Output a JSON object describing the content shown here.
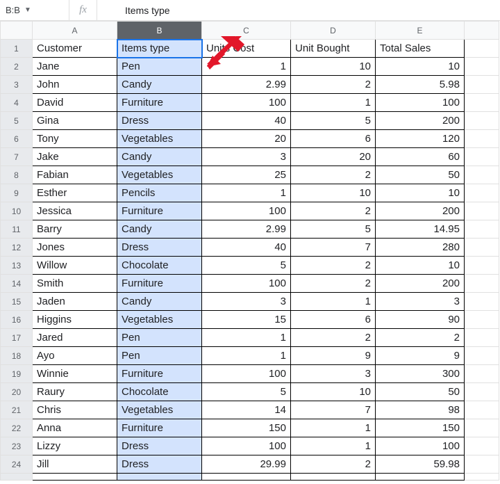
{
  "namebox": "B:B",
  "fx_label": "fx",
  "formula_value": "Items type",
  "columns": [
    "A",
    "B",
    "C",
    "D",
    "E"
  ],
  "selected_column": "B",
  "headers": [
    "Customer",
    "Items type",
    "Units Cost",
    "Unit Bought",
    "Total Sales"
  ],
  "rows": [
    {
      "n": 1,
      "a": "Customer",
      "b": "Items type",
      "c": "Units Cost",
      "d": "Unit Bought",
      "e": "Total Sales",
      "hdr": true
    },
    {
      "n": 2,
      "a": "Jane",
      "b": "Pen",
      "c": "1",
      "d": "10",
      "e": "10"
    },
    {
      "n": 3,
      "a": "John",
      "b": "Candy",
      "c": "2.99",
      "d": "2",
      "e": "5.98"
    },
    {
      "n": 4,
      "a": "David",
      "b": "Furniture",
      "c": "100",
      "d": "1",
      "e": "100"
    },
    {
      "n": 5,
      "a": "Gina",
      "b": "Dress",
      "c": "40",
      "d": "5",
      "e": "200"
    },
    {
      "n": 6,
      "a": "Tony",
      "b": "Vegetables",
      "c": "20",
      "d": "6",
      "e": "120"
    },
    {
      "n": 7,
      "a": "Jake",
      "b": "Candy",
      "c": "3",
      "d": "20",
      "e": "60"
    },
    {
      "n": 8,
      "a": "Fabian",
      "b": "Vegetables",
      "c": "25",
      "d": "2",
      "e": "50"
    },
    {
      "n": 9,
      "a": "Esther",
      "b": "Pencils",
      "c": "1",
      "d": "10",
      "e": "10"
    },
    {
      "n": 10,
      "a": "Jessica",
      "b": "Furniture",
      "c": "100",
      "d": "2",
      "e": "200"
    },
    {
      "n": 11,
      "a": "Barry",
      "b": "Candy",
      "c": "2.99",
      "d": "5",
      "e": "14.95"
    },
    {
      "n": 12,
      "a": "Jones",
      "b": "Dress",
      "c": "40",
      "d": "7",
      "e": "280"
    },
    {
      "n": 13,
      "a": "Willow",
      "b": "Chocolate",
      "c": "5",
      "d": "2",
      "e": "10"
    },
    {
      "n": 14,
      "a": "Smith",
      "b": "Furniture",
      "c": "100",
      "d": "2",
      "e": "200"
    },
    {
      "n": 15,
      "a": "Jaden",
      "b": "Candy",
      "c": "3",
      "d": "1",
      "e": "3"
    },
    {
      "n": 16,
      "a": "Higgins",
      "b": "Vegetables",
      "c": "15",
      "d": "6",
      "e": "90"
    },
    {
      "n": 17,
      "a": "Jared",
      "b": "Pen",
      "c": "1",
      "d": "2",
      "e": "2"
    },
    {
      "n": 18,
      "a": "Ayo",
      "b": "Pen",
      "c": "1",
      "d": "9",
      "e": "9"
    },
    {
      "n": 19,
      "a": "Winnie",
      "b": "Furniture",
      "c": "100",
      "d": "3",
      "e": "300"
    },
    {
      "n": 20,
      "a": "Raury",
      "b": "Chocolate",
      "c": "5",
      "d": "10",
      "e": "50"
    },
    {
      "n": 21,
      "a": "Chris",
      "b": "Vegetables",
      "c": "14",
      "d": "7",
      "e": "98"
    },
    {
      "n": 22,
      "a": "Anna",
      "b": "Furniture",
      "c": "150",
      "d": "1",
      "e": "150"
    },
    {
      "n": 23,
      "a": "Lizzy",
      "b": "Dress",
      "c": "100",
      "d": "1",
      "e": "100"
    },
    {
      "n": 24,
      "a": "Jill",
      "b": "Dress",
      "c": "29.99",
      "d": "2",
      "e": "59.98"
    }
  ]
}
